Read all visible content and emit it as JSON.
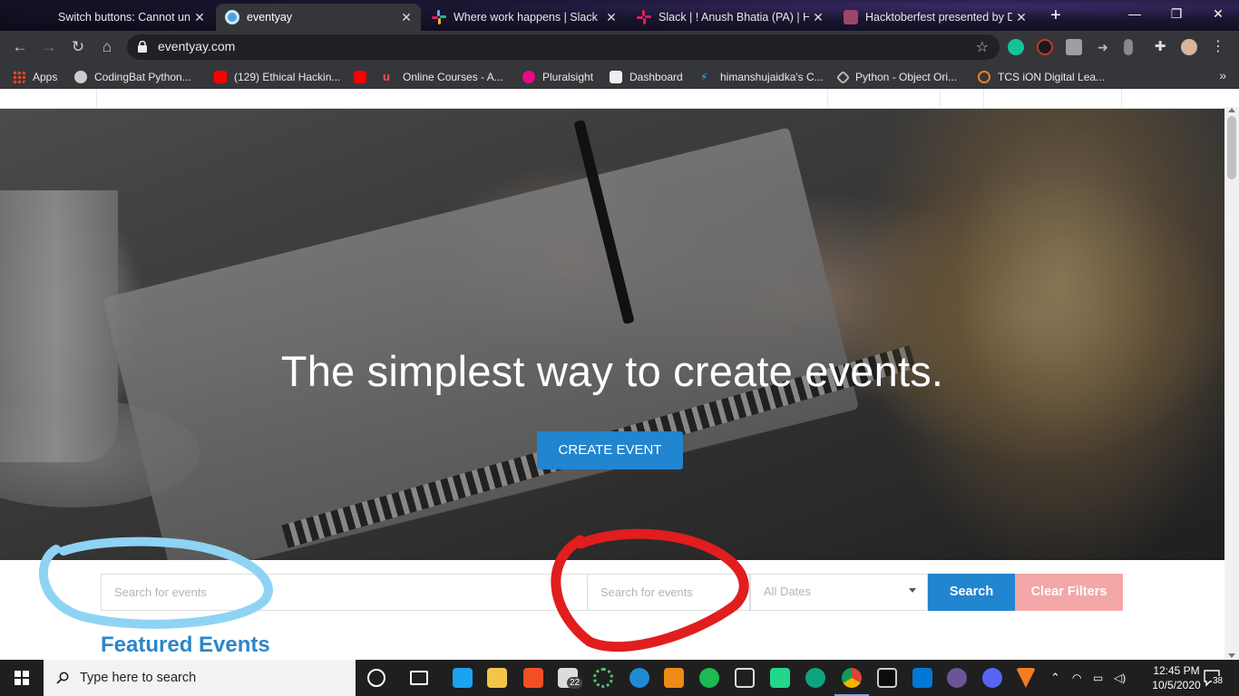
{
  "browser": {
    "tabs": [
      {
        "title": "Switch buttons: Cannot unswit",
        "favicon_color": "#f48024",
        "active": false
      },
      {
        "title": "eventyay",
        "favicon_color": "#4aa3df",
        "active": true
      },
      {
        "title": "Where work happens | Slack",
        "favicon_color": "#e01e5a",
        "active": false
      },
      {
        "title": "Slack | ! Anush Bhatia (PA) | Hal",
        "favicon_color": "#e01e5a",
        "active": false
      },
      {
        "title": "Hacktoberfest presented by Di",
        "favicon_color": "#9c4668",
        "active": false
      }
    ],
    "new_tab": "+",
    "close_glyph": "✕",
    "url": "eventyay.com",
    "bookmarks": [
      {
        "label": "Apps",
        "color": "#e9472b"
      },
      {
        "label": "CodingBat Python...",
        "color": "#cccccc"
      },
      {
        "label": "(129) Ethical Hackin...",
        "color": "#ff0000"
      },
      {
        "label": "",
        "color": "#ff0000"
      },
      {
        "label": "Online Courses - A...",
        "color": "#ec5252"
      },
      {
        "label": "Pluralsight",
        "color": "#f15b2a"
      },
      {
        "label": "Dashboard",
        "color": "#dddddd"
      },
      {
        "label": "himanshujaidka's C...",
        "color": "#4aa3df"
      },
      {
        "label": "Python - Object Ori...",
        "color": "#bbbbbb"
      },
      {
        "label": "TCS iON Digital Lea...",
        "color": "#f47b20"
      }
    ],
    "bookmarks_more": "»"
  },
  "hero": {
    "title": "The simplest way to create events.",
    "create_button": "CREATE EVENT"
  },
  "search": {
    "placeholder_1": "Search for events",
    "placeholder_2": "Search for events",
    "dates_value": "All Dates",
    "search_button": "Search",
    "clear_button": "Clear Filters"
  },
  "featured_heading": "Featured Events",
  "colors": {
    "primary": "#2185d0",
    "clear_filters": "#f3a7a7",
    "heading_blue": "#2c86c9",
    "annotation_blue": "#8fd3f4",
    "annotation_red": "#e11d1d"
  },
  "taskbar": {
    "search_placeholder": "Type here to search",
    "time": "12:45 PM",
    "date": "10/5/2020",
    "mail_badge": "22",
    "notification_count": "38"
  }
}
